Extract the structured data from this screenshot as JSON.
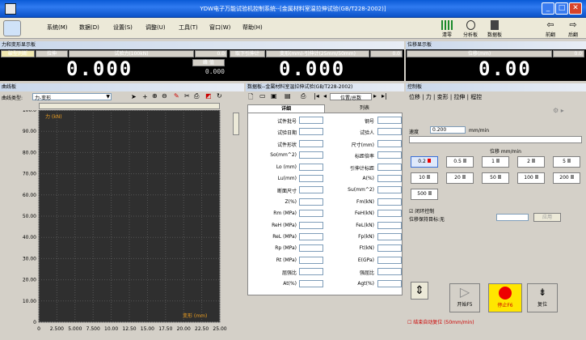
{
  "window": {
    "title": "YDW电子万能试验机控制系统--[金属材料室温拉伸试验(GB/T228-2002)]"
  },
  "menu": [
    "系统(M)",
    "数据(D)",
    "设置(S)",
    "调整(U)",
    "工具(T)",
    "窗口(W)",
    "帮助(H)"
  ],
  "toolbar": {
    "items": [
      "清零",
      "分析板",
      "数据板",
      "前翻",
      "后翻"
    ]
  },
  "force_panel": {
    "title": "力和变形显示板",
    "tabs": [
      "破型判断",
      "拉伸"
    ],
    "force_label": "试验力(100kN)",
    "force_unit": "0.0",
    "force_value": "0.000",
    "peak_label": "峰  值",
    "peak_value": "0.000",
    "strain_label": "变形(mm)-引伸计(25mm/50mm)",
    "strain_unit": "0.0",
    "strain_button": "取下引伸计",
    "strain_value": "0.000"
  },
  "disp_panel": {
    "title": "位移显示板",
    "label": "位移(mm)",
    "unit": "0.0",
    "value": "0.00"
  },
  "curve_panel": {
    "title": "曲线板",
    "type_label": "曲线类型:",
    "type_value": "力-变形",
    "y_unit": "力 (kN)",
    "x_unit": "变形 (mm)"
  },
  "chart_data": {
    "type": "line",
    "yticks": [
      "100.0",
      "90.00",
      "80.00",
      "70.00",
      "60.00",
      "50.00",
      "40.00",
      "30.00",
      "20.00",
      "10.00",
      "0"
    ],
    "xticks": [
      "0",
      "2.500",
      "5.000",
      "7.500",
      "10.00",
      "12.50",
      "15.00",
      "17.50",
      "20.00",
      "22.50",
      "25.00"
    ],
    "ylabel": "力 (kN)",
    "xlabel": "变形 (mm)",
    "xlim": [
      0,
      25
    ],
    "ylim": [
      0,
      100
    ],
    "grid": true,
    "series": []
  },
  "data_panel": {
    "title": "数据板--金属材料室温拉伸试验(GB/T228-2002)",
    "nav": "位置/总数",
    "tab_detail": "详细",
    "tab_list": "列表",
    "left": [
      "试件批号",
      "试验日期",
      "试件形状",
      "So(mm^2)",
      "Lo (mm)",
      "Lu(mm)",
      "断面尺寸",
      "Z(%)",
      "Rm (MPa)",
      "ReH (MPa)",
      "ReL (MPa)",
      "Rp (MPa)",
      "Rt (MPa)",
      "屈强比",
      "At(%)"
    ],
    "right": [
      "钢号",
      "试验人",
      "尺寸(mm)",
      "标距倍率",
      "引伸计标距",
      "A(%)",
      "Su(mm^2)",
      "Fm(kN)",
      "FeH(kN)",
      "FeL(kN)",
      "Fp(kN)",
      "Ft(kN)",
      "E(GPa)",
      "强屈比",
      "Agt(%)"
    ]
  },
  "control_panel": {
    "title": "控制板",
    "tabs": [
      "位移",
      "力",
      "变形",
      "拉伸",
      "程控"
    ],
    "speed_label": "速度",
    "speed_value": "0.200",
    "speed_unit": "mm/min",
    "pos_label": "位移 mm/min",
    "speeds": [
      "0.2",
      "0.5",
      "1",
      "2",
      "5",
      "10",
      "20",
      "50",
      "100",
      "200",
      "500"
    ],
    "closed_loop": "闭环控制",
    "hold_label": "位移保持目标:无",
    "apply": "应用",
    "start": "开始F5",
    "stop": "停止F6",
    "reset": "复位",
    "auto_reset": "结束自动复位 (50mm/min)"
  }
}
